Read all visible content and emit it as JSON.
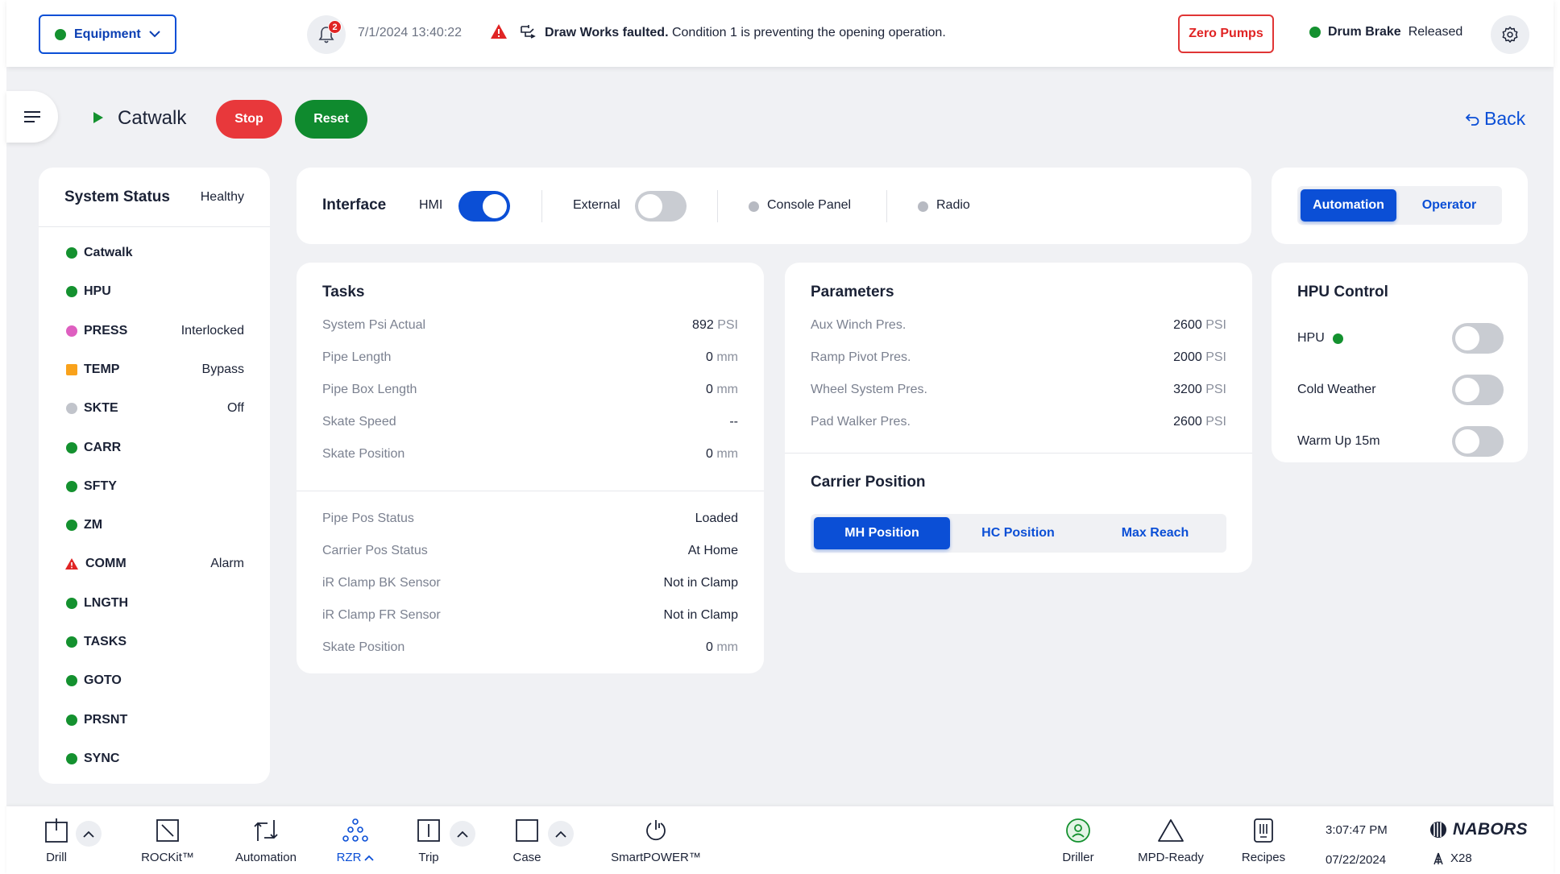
{
  "header": {
    "equipment_label": "Equipment",
    "notification_count": "2",
    "datetime": "7/1/2024  13:40:22",
    "fault_bold": "Draw Works faulted.",
    "fault_text": " Condition 1 is preventing the opening operation.",
    "zero_pumps_label": "Zero Pumps",
    "drum_brake_label": "Drum Brake",
    "drum_brake_state": "Released"
  },
  "page": {
    "title": "Catwalk",
    "stop_label": "Stop",
    "reset_label": "Reset",
    "back_label": "Back"
  },
  "system_status": {
    "title": "System Status",
    "health": "Healthy",
    "items": [
      {
        "label": "Catwalk",
        "value": "",
        "indicator": "green"
      },
      {
        "label": "HPU",
        "value": "",
        "indicator": "green"
      },
      {
        "label": "PRESS",
        "value": "Interlocked",
        "indicator": "pink"
      },
      {
        "label": "TEMP",
        "value": "Bypass",
        "indicator": "orange"
      },
      {
        "label": "SKTE",
        "value": "Off",
        "indicator": "gray"
      },
      {
        "label": "CARR",
        "value": "",
        "indicator": "green"
      },
      {
        "label": "SFTY",
        "value": "",
        "indicator": "green"
      },
      {
        "label": "ZM",
        "value": "",
        "indicator": "green"
      },
      {
        "label": "COMM",
        "value": "Alarm",
        "indicator": "alarm"
      },
      {
        "label": "LNGTH",
        "value": "",
        "indicator": "green"
      },
      {
        "label": "TASKS",
        "value": "",
        "indicator": "green"
      },
      {
        "label": "GOTO",
        "value": "",
        "indicator": "green"
      },
      {
        "label": "PRSNT",
        "value": "",
        "indicator": "green"
      },
      {
        "label": "SYNC",
        "value": "",
        "indicator": "green"
      }
    ]
  },
  "interface": {
    "title": "Interface",
    "hmi_label": "HMI",
    "hmi_on": true,
    "external_label": "External",
    "external_on": false,
    "console_label": "Console Panel",
    "radio_label": "Radio"
  },
  "mode": {
    "automation_label": "Automation",
    "operator_label": "Operator",
    "selected": "Automation"
  },
  "tasks": {
    "title": "Tasks",
    "group1": [
      {
        "label": "System Psi Actual",
        "value": "892",
        "unit": "PSI"
      },
      {
        "label": "Pipe Length",
        "value": "0",
        "unit": "mm"
      },
      {
        "label": "Pipe Box Length",
        "value": "0",
        "unit": "mm"
      },
      {
        "label": "Skate Speed",
        "value": "--",
        "unit": ""
      },
      {
        "label": "Skate Position",
        "value": "0",
        "unit": "mm"
      }
    ],
    "group2": [
      {
        "label": "Pipe Pos Status",
        "value": "Loaded",
        "unit": ""
      },
      {
        "label": "Carrier Pos Status",
        "value": "At Home",
        "unit": ""
      },
      {
        "label": "iR Clamp BK Sensor",
        "value": "Not in Clamp",
        "unit": ""
      },
      {
        "label": "iR Clamp FR Sensor",
        "value": "Not in Clamp",
        "unit": ""
      },
      {
        "label": "Skate Position",
        "value": "0",
        "unit": "mm"
      }
    ]
  },
  "parameters": {
    "title": "Parameters",
    "rows": [
      {
        "label": "Aux Winch Pres.",
        "value": "2600",
        "unit": "PSI"
      },
      {
        "label": "Ramp Pivot Pres.",
        "value": "2000",
        "unit": "PSI"
      },
      {
        "label": "Wheel System Pres.",
        "value": "3200",
        "unit": "PSI"
      },
      {
        "label": "Pad Walker Pres.",
        "value": "2600",
        "unit": "PSI"
      }
    ],
    "carrier_title": "Carrier Position",
    "carrier_options": [
      "MH Position",
      "HC Position",
      "Max Reach"
    ],
    "carrier_selected": "MH Position"
  },
  "hpu_control": {
    "title": "HPU Control",
    "rows": [
      {
        "label": "HPU",
        "status_dot": true,
        "on": false
      },
      {
        "label": "Cold Weather",
        "status_dot": false,
        "on": false
      },
      {
        "label": "Warm Up 15m",
        "status_dot": false,
        "on": false
      }
    ]
  },
  "bottom_nav": {
    "items": [
      "Drill",
      "ROCKit™",
      "Automation",
      "RZR",
      "Trip",
      "Case",
      "SmartPOWER™",
      "Driller",
      "MPD-Ready",
      "Recipes"
    ],
    "active": "RZR",
    "time": "3:07:47 PM",
    "date": "07/22/2024",
    "brand": "NABORS",
    "rig": "X28"
  },
  "colors": {
    "primary": "#0b4fd6",
    "ok": "#14912f",
    "danger": "#e8383b",
    "warning": "#f9a21b",
    "interlocked": "#de5fc0",
    "background": "#f0f1f4"
  }
}
